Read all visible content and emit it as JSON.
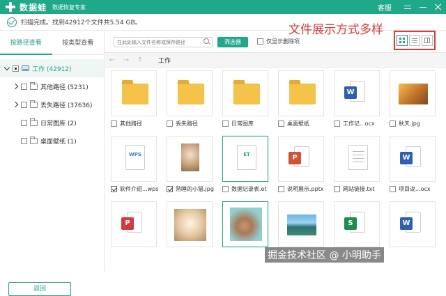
{
  "app": {
    "brand": "数据蛙",
    "subtitle": "数据恢复专家",
    "kefu": "客服"
  },
  "status": {
    "text": "扫描完成。找到42912个文件共5.54 GB。"
  },
  "sidebar": {
    "tabs": [
      "按路径查看",
      "按类型查看"
    ],
    "active_tab": 0,
    "tree": [
      {
        "label": "工作 (42912)",
        "level": 0
      },
      {
        "label": "其他路径 (5231)",
        "level": 1
      },
      {
        "label": "丢失路径 (37636)",
        "level": 1
      },
      {
        "label": "日常图库 (2)",
        "level": 1
      },
      {
        "label": "桌面壁纸 (1)",
        "level": 1
      }
    ]
  },
  "toolbar": {
    "search_placeholder": "在此处输入文件名称或保存路径",
    "filter_label": "筛选器",
    "only_deleted_label": "仅显示删除项",
    "annotation": "文件展示方式多样"
  },
  "pathbar": {
    "path": "工作"
  },
  "files": [
    {
      "name": "其他路径",
      "kind": "folder",
      "checked": false
    },
    {
      "name": "丢失路径",
      "kind": "folder",
      "checked": false
    },
    {
      "name": "日常图库",
      "kind": "folder",
      "checked": false
    },
    {
      "name": "桌面壁纸",
      "kind": "folder",
      "checked": false
    },
    {
      "name": "工作记...ocx",
      "kind": "word",
      "checked": false
    },
    {
      "name": "秋天.jpg",
      "kind": "autumn",
      "checked": false
    },
    {
      "name": "软件介绍...wps",
      "kind": "wps",
      "checked": true
    },
    {
      "name": "熟睡的小猫.jpg",
      "kind": "cat",
      "checked": true
    },
    {
      "name": "数据记录表.et",
      "kind": "et",
      "checked": false
    },
    {
      "name": "说明展示.pptx",
      "kind": "ppt",
      "checked": false
    },
    {
      "name": "网站链接.txt",
      "kind": "txt",
      "checked": false
    },
    {
      "name": "项目说...ocx",
      "kind": "word",
      "checked": false
    },
    {
      "name": "",
      "kind": "pdf",
      "checked": false
    },
    {
      "name": "",
      "kind": "kitten",
      "checked": false
    },
    {
      "name": "",
      "kind": "rabbit",
      "checked": false
    },
    {
      "name": "",
      "kind": "lake",
      "checked": false
    },
    {
      "name": "",
      "kind": "xls",
      "checked": false
    },
    {
      "name": "",
      "kind": "word",
      "checked": false
    }
  ],
  "footer": {
    "back_label": "返回"
  },
  "watermark": "掘金技术社区 @ 小明助手",
  "colors": {
    "accent": "#1fa889",
    "annotation": "#e53935"
  }
}
